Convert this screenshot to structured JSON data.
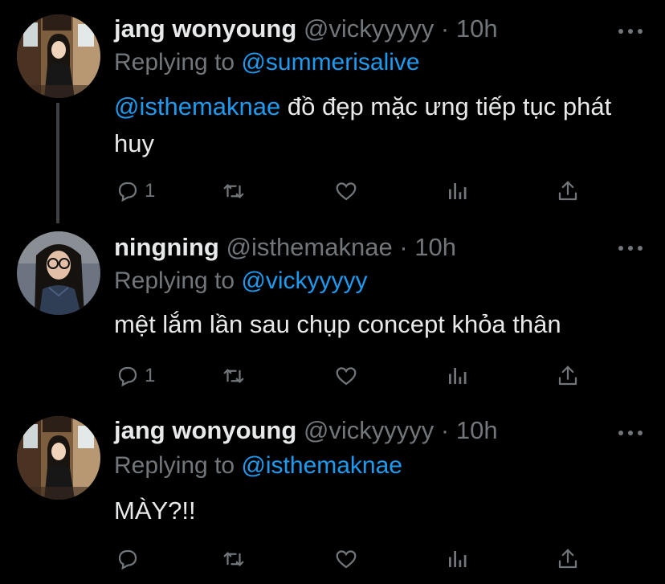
{
  "tweets": [
    {
      "name": "jang wonyoung",
      "handle": "@vickyyyyy",
      "dot": "·",
      "time": "10h",
      "replying_prefix": "Replying to",
      "replying_to": "@summerisalive",
      "mention": "@isthemaknae",
      "text": " đồ đẹp mặc ưng tiếp tục phát huy",
      "reply_count": "1",
      "retweet_count": "",
      "like_count": ""
    },
    {
      "name": "ningning",
      "handle": "@isthemaknae",
      "dot": "·",
      "time": "10h",
      "replying_prefix": "Replying to",
      "replying_to": "@vickyyyyy",
      "mention": "",
      "text": "mệt lắm lần sau chụp concept khỏa thân",
      "reply_count": "1",
      "retweet_count": "",
      "like_count": ""
    },
    {
      "name": "jang wonyoung",
      "handle": "@vickyyyyy",
      "dot": "·",
      "time": "10h",
      "replying_prefix": "Replying to",
      "replying_to": "@isthemaknae",
      "mention": "",
      "text": "MÀY?!!",
      "reply_count": "",
      "retweet_count": "",
      "like_count": ""
    }
  ],
  "icons": {
    "reply": "reply-icon",
    "retweet": "retweet-icon",
    "like": "heart-icon",
    "analytics": "analytics-icon",
    "share": "share-icon",
    "more": "more-icon"
  },
  "colors": {
    "background": "#000000",
    "text": "#e7e9ea",
    "secondary": "#71767b",
    "link": "#1d9bf0",
    "thread_line": "#3e4144"
  }
}
